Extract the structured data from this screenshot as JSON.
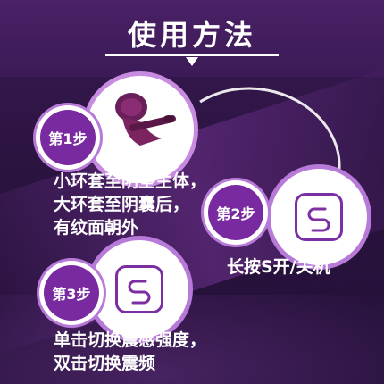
{
  "header": {
    "title": "使用方法"
  },
  "step1": {
    "badge": "第1步",
    "lines": [
      "小环套至阴茎主体，",
      "大环套至阴囊后，",
      "有纹面朝外"
    ]
  },
  "step2": {
    "badge": "第2步",
    "line": "长按S开/关机"
  },
  "step3": {
    "badge": "第3步",
    "lines": [
      "单击切换震感强度，",
      "双击切换震频"
    ]
  },
  "icons": {
    "power": "s-power-icon",
    "product": "vibrating-ring-product",
    "arrow": "arrow-down-icon"
  },
  "colors": {
    "background": "#2b1440",
    "accent": "#7a2aa0",
    "ring": "#b77ad8",
    "text": "#ffffff"
  }
}
